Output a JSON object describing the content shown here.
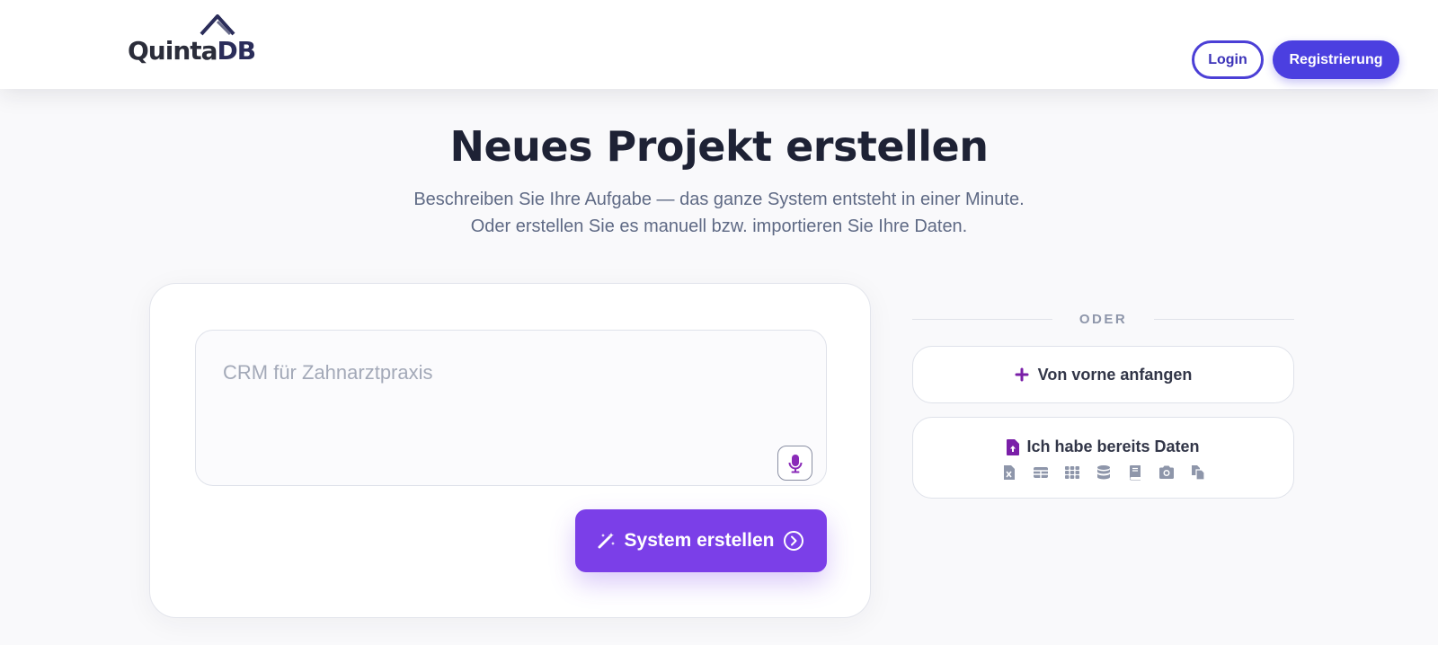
{
  "header": {
    "logo_text_a": "Quinta",
    "logo_text_b": "DB",
    "login_label": "Login",
    "register_label": "Registrierung"
  },
  "hero": {
    "title": "Neues Projekt erstellen",
    "subtitle_line1": "Beschreiben Sie Ihre Aufgabe — das ganze System entsteht in einer Minute.",
    "subtitle_line2": "Oder erstellen Sie es manuell bzw. importieren Sie Ihre Daten."
  },
  "prompt": {
    "placeholder": "CRM für Zahnarztpraxis",
    "value": "",
    "mic_icon": "microphone-icon",
    "create_label": "System erstellen",
    "create_icon": "magic-wand-icon",
    "arrow_icon": "circle-chevron-right-icon"
  },
  "alternatives": {
    "divider_label": "ODER",
    "scratch_label": "Von vorne anfangen",
    "scratch_icon": "plus-icon",
    "data_label": "Ich habe bereits Daten",
    "data_icon": "file-upload-icon",
    "import_icons": [
      "excel-file-icon",
      "table-icon",
      "grid-icon",
      "database-icon",
      "book-icon",
      "camera-icon",
      "copy-files-icon"
    ]
  },
  "colors": {
    "brand": "#4b3fe0",
    "accent": "#7b3fe8",
    "icon_purple": "#7a1fa8",
    "muted_icon": "#8e96aa"
  }
}
